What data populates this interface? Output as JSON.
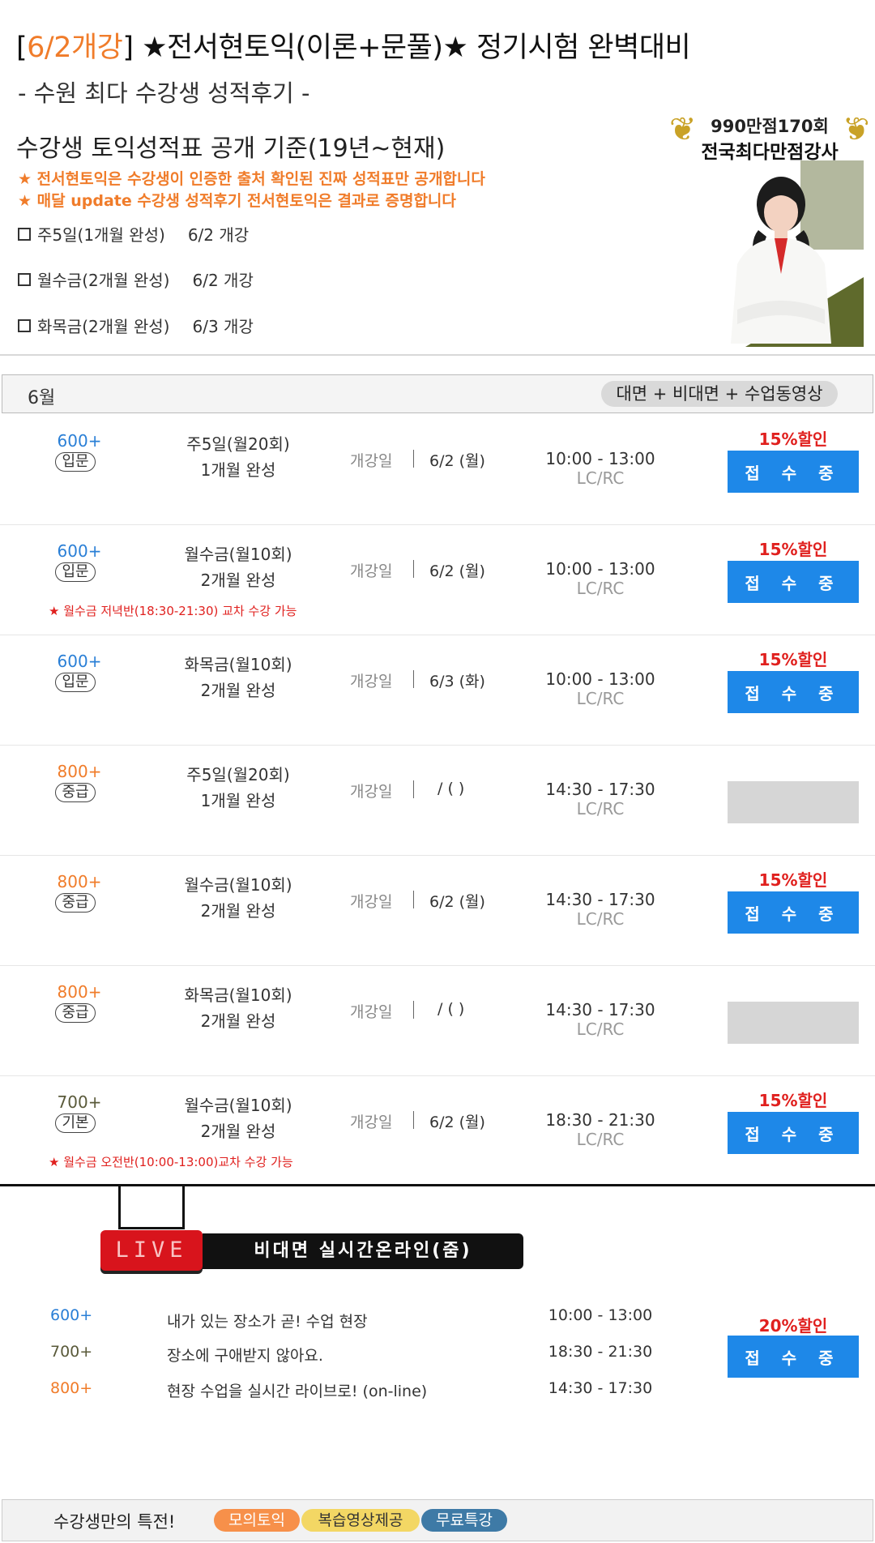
{
  "header": {
    "title_bracket_open": "[",
    "title_highlight": "6/2개강",
    "title_rest": "] ★전서현토익(이론+문풀)★ 정기시험 완벽대비",
    "subtitle": "- 수원 최다 수강생 성적후기 -",
    "policy_title": "수강생 토익성적표 공개 기준(19년~현재)",
    "notice_1": "★ 전서현토익은 수강생이 인증한 출처 확인된 진짜 성적표만 공개합니다",
    "notice_2": "★ 매달 update 수강생 성적후기 전서현토익은 결과로 증명합니다",
    "schedule": [
      {
        "name": "주5일(1개월 완성)",
        "open": "6/2 개강"
      },
      {
        "name": "월수금(2개월 완성)",
        "open": "6/2 개강"
      },
      {
        "name": "화목금(2개월 완성)",
        "open": "6/3 개강"
      }
    ]
  },
  "award": {
    "line1": "990만점170회",
    "line2": "전국최다만점강사"
  },
  "month_bar": {
    "month": "6월",
    "mode": "대면 + 비대면 + 수업동영상"
  },
  "rows": [
    {
      "level": "600+",
      "tag": "입문",
      "days": "주5일(월20회)",
      "duration": "1개월 완성",
      "note": "",
      "open_label": "개강일",
      "date": "6/2 (월)",
      "time": "10:00 - 13:00",
      "sub": "LC/RC",
      "discount": "15%할인",
      "button": "접 수 중"
    },
    {
      "level": "600+",
      "tag": "입문",
      "days": "월수금(월10회)",
      "duration": "2개월 완성",
      "note": "★ 월수금 저녁반(18:30-21:30) 교차 수강 가능",
      "open_label": "개강일",
      "date": "6/2 (월)",
      "time": "10:00 - 13:00",
      "sub": "LC/RC",
      "discount": "15%할인",
      "button": "접 수 중"
    },
    {
      "level": "600+",
      "tag": "입문",
      "days": "화목금(월10회)",
      "duration": "2개월 완성",
      "note": "",
      "open_label": "개강일",
      "date": "6/3 (화)",
      "time": "10:00 - 13:00",
      "sub": "LC/RC",
      "discount": "15%할인",
      "button": "접 수 중"
    },
    {
      "level": "800+",
      "tag": "중급",
      "days": "주5일(월20회)",
      "duration": "1개월 완성",
      "note": "",
      "open_label": "개강일",
      "date": "/ (  )",
      "time": "14:30 - 17:30",
      "sub": "LC/RC",
      "discount": "",
      "button": ""
    },
    {
      "level": "800+",
      "tag": "중급",
      "days": "월수금(월10회)",
      "duration": "2개월 완성",
      "note": "",
      "open_label": "개강일",
      "date": "6/2 (월)",
      "time": "14:30 - 17:30",
      "sub": "LC/RC",
      "discount": "15%할인",
      "button": "접 수 중"
    },
    {
      "level": "800+",
      "tag": "중급",
      "days": "화목금(월10회)",
      "duration": "2개월 완성",
      "note": "",
      "open_label": "개강일",
      "date": "/ (  )",
      "time": "14:30 - 17:30",
      "sub": "LC/RC",
      "discount": "",
      "button": ""
    },
    {
      "level": "700+",
      "tag": "기본",
      "days": "월수금(월10회)",
      "duration": "2개월 완성",
      "note": "★ 월수금 오전반(10:00-13:00)교차 수강 가능",
      "open_label": "개강일",
      "date": "6/2 (월)",
      "time": "18:30 - 21:30",
      "sub": "LC/RC",
      "discount": "15%할인",
      "button": "접 수 중"
    }
  ],
  "online": {
    "live_label": "LIVE",
    "banner": "비대면 실시간온라인(줌)",
    "items": [
      {
        "level": "600+",
        "text": "내가 있는 장소가 곧! 수업 현장",
        "time": "10:00 - 13:00"
      },
      {
        "level": "700+",
        "text": "장소에 구애받지 않아요.",
        "time": "18:30 - 21:30"
      },
      {
        "level": "800+",
        "text": "현장 수업을 실시간 라이브로! (on-line)",
        "time": "14:30 - 17:30"
      }
    ],
    "discount": "20%할인",
    "button": "접 수 중"
  },
  "benefits": {
    "label": "수강생만의 특전!",
    "pills": [
      "모의토익",
      "복습영상제공",
      "무료특강"
    ]
  },
  "colors": {
    "accent_orange": "#f07c2a",
    "button_blue": "#1e88e8",
    "discount_red": "#e0201e",
    "level_600": "#2a7fd6",
    "level_800": "#f07c2a",
    "level_700": "#5a5a3a"
  }
}
